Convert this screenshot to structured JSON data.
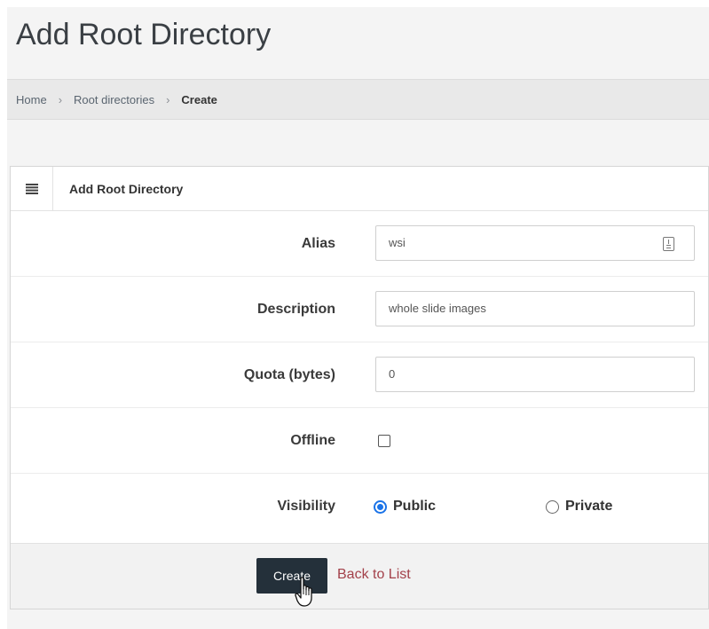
{
  "page": {
    "title": "Add Root Directory"
  },
  "breadcrumb": {
    "items": [
      "Home",
      "Root directories",
      "Create"
    ],
    "separator": "›"
  },
  "card": {
    "title": "Add Root Directory",
    "icon": "list-icon"
  },
  "form": {
    "alias": {
      "label": "Alias",
      "value": "wsi"
    },
    "description": {
      "label": "Description",
      "value": "whole slide images"
    },
    "quota": {
      "label": "Quota (bytes)",
      "value": "0"
    },
    "offline": {
      "label": "Offline",
      "checked": false
    },
    "visibility": {
      "label": "Visibility",
      "options": [
        {
          "label": "Public",
          "checked": true
        },
        {
          "label": "Private",
          "checked": false
        }
      ]
    }
  },
  "actions": {
    "create_label": "Create",
    "back_label": "Back to List"
  },
  "colors": {
    "primary_button": "#24303a",
    "link": "#a3414a",
    "radio_selected": "#1a73e8"
  }
}
